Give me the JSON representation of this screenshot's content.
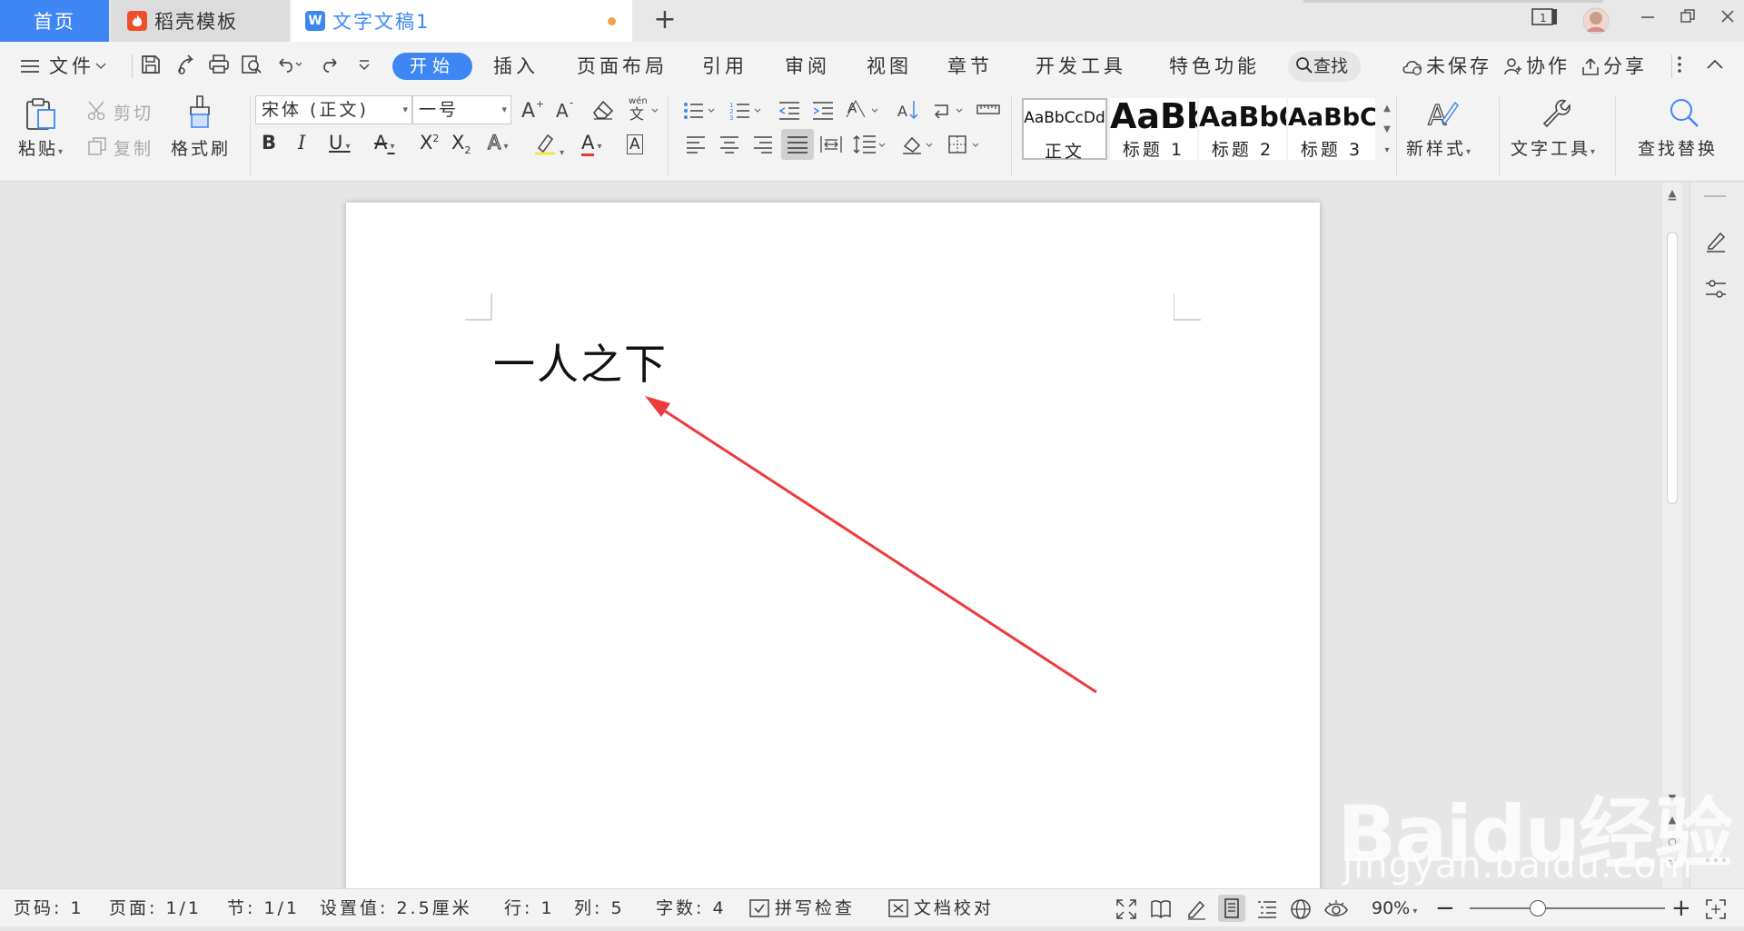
{
  "tabs": {
    "home": "首页",
    "template": "稻壳模板",
    "document": "文字文稿1",
    "doc_icon_letter": "W",
    "new_tab": "+"
  },
  "window": {
    "page_indicator": "1"
  },
  "menu": {
    "file": "文件",
    "start": "开始",
    "insert": "插入",
    "page_layout": "页面布局",
    "reference": "引用",
    "review": "审阅",
    "view": "视图",
    "chapter": "章节",
    "developer": "开发工具",
    "special": "特色功能",
    "search": "查找",
    "unsaved": "未保存",
    "collab": "协作",
    "share": "分享"
  },
  "ribbon": {
    "paste": "粘贴",
    "cut": "剪切",
    "copy": "复制",
    "format_painter": "格式刷",
    "font_name": "宋体 (正文)",
    "font_size": "一号",
    "new_style": "新样式",
    "text_tools": "文字工具",
    "find_replace": "查找替换",
    "styles": [
      {
        "sample": "AaBbCcDd",
        "name": "正文"
      },
      {
        "sample": "AaBb",
        "name": "标题 1"
      },
      {
        "sample": "AaBbC",
        "name": "标题 2"
      },
      {
        "sample": "AaBbC",
        "name": "标题 3"
      }
    ]
  },
  "document": {
    "text": "一人之下"
  },
  "status": {
    "page_code": "页码: 1",
    "page": "页面: 1/1",
    "section": "节: 1/1",
    "setting": "设置值: 2.5厘米",
    "row": "行: 1",
    "col": "列: 5",
    "word_count": "字数: 4",
    "spell_check": "拼写检查",
    "doc_proof": "文档校对",
    "zoom": "90%",
    "zoom_level": 0.35
  },
  "watermark": {
    "brand": "Baidu经验",
    "url": "jingyan.baidu.com"
  },
  "colors": {
    "accent": "#3f86f5",
    "annotation_arrow": "#ee3a3a"
  }
}
